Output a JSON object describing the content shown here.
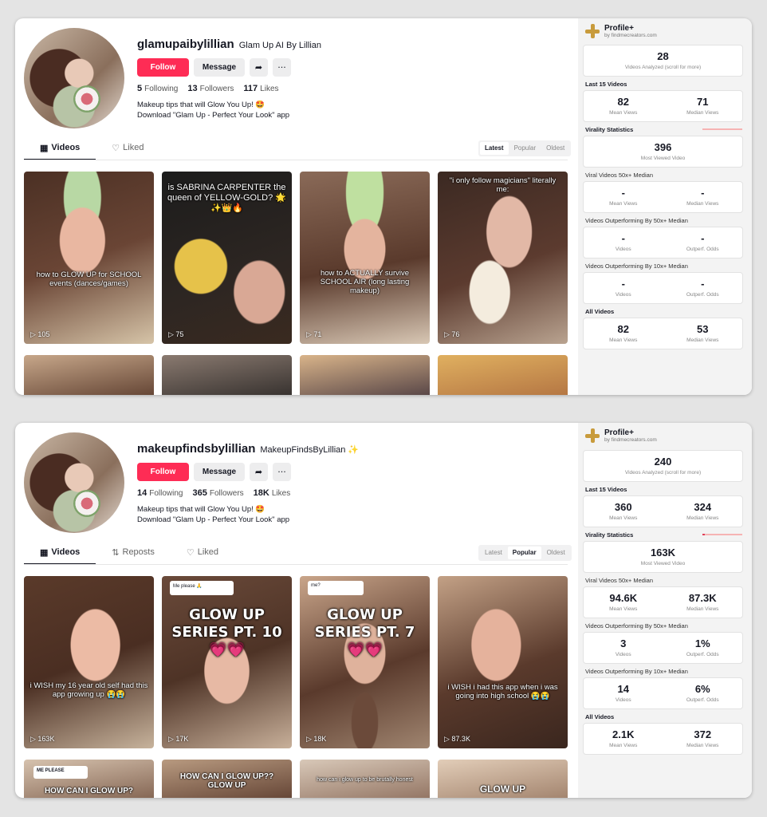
{
  "panels": [
    {
      "username": "glamupaibylillian",
      "display_name": "Glam Up AI By Lillian",
      "follow_label": "Follow",
      "message_label": "Message",
      "share_icon": "share-icon",
      "more_label": "···",
      "following_count": "5",
      "following_label": "Following",
      "followers_count": "13",
      "followers_label": "Followers",
      "likes_count": "117",
      "likes_label": "Likes",
      "bio_line1": "Makeup tips that will Glow You Up! 🤩",
      "bio_line2": "Download \"Glam Up - Perfect Your Look\" app",
      "tabs": [
        "Videos",
        "Liked"
      ],
      "sort": [
        "Latest",
        "Popular",
        "Oldest"
      ],
      "sort_active": "Latest",
      "videos": [
        {
          "caption": "how to GLOW UP for SCHOOL events (dances/games)",
          "views": "105"
        },
        {
          "caption": "is SABRINA CARPENTER the queen of YELLOW-GOLD? 🌟✨👑🔥",
          "views": "75"
        },
        {
          "caption": "how to ACTUALLY survive SCHOOL AIR (long lasting makeup)",
          "views": "71"
        },
        {
          "caption": "\"i only follow magicians\" literally me:",
          "views": "76"
        }
      ],
      "sidebar": {
        "title": "Profile+",
        "subtitle": "by findmecreators.com",
        "analyzed": "28",
        "analyzed_label": "Videos Analyzed (scroll for more)",
        "last15_title": "Last 15 Videos",
        "last15_mean": "82",
        "last15_median": "71",
        "mean_label": "Mean Views",
        "median_label": "Median Views",
        "virality_title": "Virality Statistics",
        "most_viewed": "396",
        "most_viewed_label": "Most Viewed Video",
        "viral_title": "Viral Videos 50x+ Median",
        "viral_mean": "-",
        "viral_median": "-",
        "out50_title": "Videos Outperforming By 50x+ Median",
        "out50_videos": "-",
        "out50_odds": "-",
        "out10_title": "Videos Outperforming By 10x+ Median",
        "out10_videos": "-",
        "out10_odds": "-",
        "videos_label": "Videos",
        "odds_label": "Outperf. Odds",
        "all_title": "All Videos",
        "all_mean": "82",
        "all_median": "53"
      }
    },
    {
      "username": "makeupfindsbylillian",
      "display_name": "MakeupFindsByLillian ✨",
      "follow_label": "Follow",
      "message_label": "Message",
      "share_icon": "share-icon",
      "more_label": "···",
      "following_count": "14",
      "following_label": "Following",
      "followers_count": "365",
      "followers_label": "Followers",
      "likes_count": "18K",
      "likes_label": "Likes",
      "bio_line1": "Makeup tips that will Glow You Up! 🤩",
      "bio_line2": "Download \"Glam Up - Perfect Your Look\" app",
      "tabs": [
        "Videos",
        "Reposts",
        "Liked"
      ],
      "sort": [
        "Latest",
        "Popular",
        "Oldest"
      ],
      "sort_active": "Popular",
      "videos": [
        {
          "caption": "i WISH my 16 year old self had this app growing up 😭😭",
          "views": "163K"
        },
        {
          "caption": "GLOW UP SERIES PT. 10 💗💗",
          "views": "17K"
        },
        {
          "caption": "GLOW UP SERIES PT. 7 💗💗",
          "views": "18K"
        },
        {
          "caption": "i WISH i had this app when i was going into high school 😭😭",
          "views": "87.3K"
        }
      ],
      "reply_chips": [
        "Me please 🙏",
        "me?",
        "ME PLEASE"
      ],
      "row2": [
        "HOW CAN I GLOW UP?",
        "HOW CAN I GLOW UP?? GLOW UP",
        "how can i glow up to be brutally honest",
        "GLOW UP"
      ],
      "sidebar": {
        "title": "Profile+",
        "subtitle": "by findmecreators.com",
        "analyzed": "240",
        "analyzed_label": "Videos Analyzed (scroll for more)",
        "last15_title": "Last 15 Videos",
        "last15_mean": "360",
        "last15_median": "324",
        "mean_label": "Mean Views",
        "median_label": "Median Views",
        "virality_title": "Virality Statistics",
        "most_viewed": "163K",
        "most_viewed_label": "Most Viewed Video",
        "viral_title": "Viral Videos 50x+ Median",
        "viral_mean": "94.6K",
        "viral_median": "87.3K",
        "out50_title": "Videos Outperforming By 50x+ Median",
        "out50_videos": "3",
        "out50_odds": "1%",
        "out10_title": "Videos Outperforming By 10x+ Median",
        "out10_videos": "14",
        "out10_odds": "6%",
        "videos_label": "Videos",
        "odds_label": "Outperf. Odds",
        "all_title": "All Videos",
        "all_mean": "2.1K",
        "all_median": "372"
      }
    }
  ],
  "colors": {
    "follow": "#fe2c55",
    "sidebar_bg": "#f3f3f3",
    "logo": "#c89b3c",
    "virality_bar": "#f6b3b3"
  }
}
